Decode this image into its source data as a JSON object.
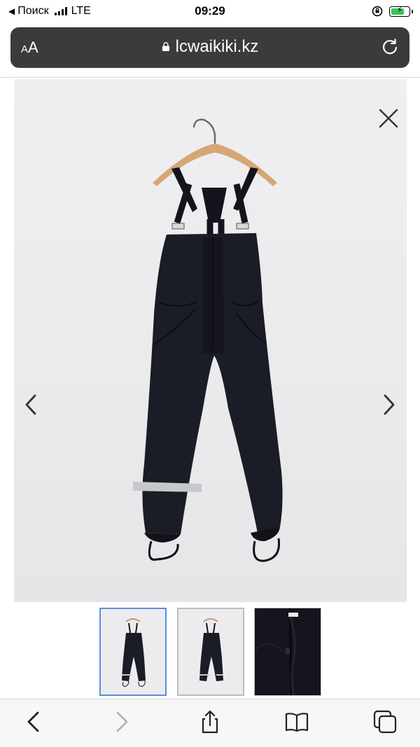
{
  "status_bar": {
    "back_label": "Поиск",
    "network": "LTE",
    "time": "09:29",
    "battery_fill": 0.8,
    "battery_color": "#35c759"
  },
  "address_bar": {
    "text_size_label": "AA",
    "url": "lcwaikiki.kz",
    "background": "#3b3b3b"
  },
  "gallery": {
    "current_index": 1,
    "thumbnails": [
      {
        "name": "overalls-front",
        "selected": true
      },
      {
        "name": "overalls-front-alt",
        "selected": false
      },
      {
        "name": "zipper-detail",
        "selected": false
      }
    ],
    "selected_border_color": "#5a8edb"
  },
  "icons": {
    "close": "close-icon",
    "prev": "chevron-left-icon",
    "next": "chevron-right-icon",
    "lock": "lock-icon",
    "reload": "reload-icon",
    "back": "back-icon",
    "forward": "forward-icon",
    "share": "share-icon",
    "bookmarks": "bookmarks-icon",
    "tabs": "tabs-icon"
  }
}
